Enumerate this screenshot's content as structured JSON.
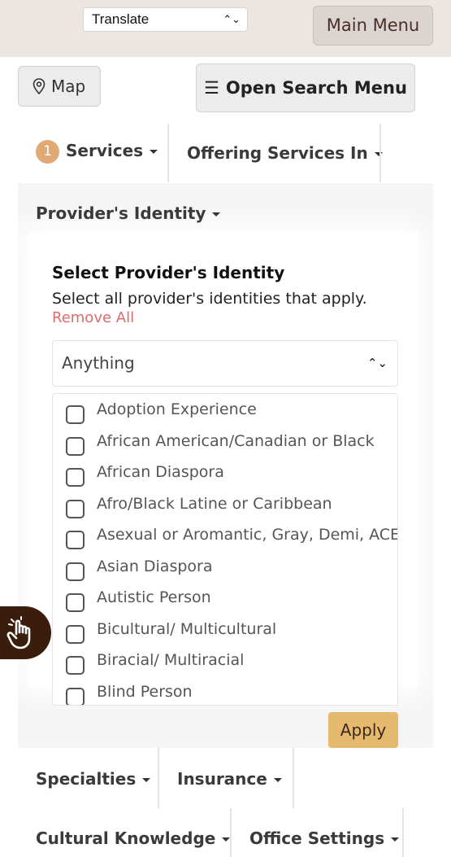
{
  "header": {
    "translate_label": "Translate",
    "main_menu_label": "Main Menu"
  },
  "toolbar": {
    "map_label": "Map",
    "open_search_label": "Open Search Menu"
  },
  "tabs": {
    "services_badge": "1",
    "services_label": "Services",
    "offering_label": "Offering Services In",
    "identity_label": "Provider's Identity",
    "specialties_label": "Specialties",
    "insurance_label": "Insurance",
    "cultural_label": "Cultural Knowledge",
    "office_label": "Office Settings"
  },
  "identity_panel": {
    "heading": "Select Provider's Identity",
    "subtext": "Select all provider's identities that apply.",
    "remove_all": "Remove All",
    "select_value": "Anything",
    "options": [
      "Adoption Experience",
      "African American/Canadian or Black",
      "African Diaspora",
      "Afro/Black Latine or Caribbean",
      "Asexual or Aromantic, Gray, Demi, ACE",
      "Asian Diaspora",
      "Autistic Person",
      "Bicultural/ Multicultural",
      "Biracial/ Multiracial",
      "Blind Person"
    ],
    "apply_label": "Apply"
  },
  "colors": {
    "apply_bg": "#e5b96e",
    "badge_bg": "#e0a874",
    "remove_text": "#e06a6a",
    "accessibility_bg": "#3a1d0c"
  }
}
